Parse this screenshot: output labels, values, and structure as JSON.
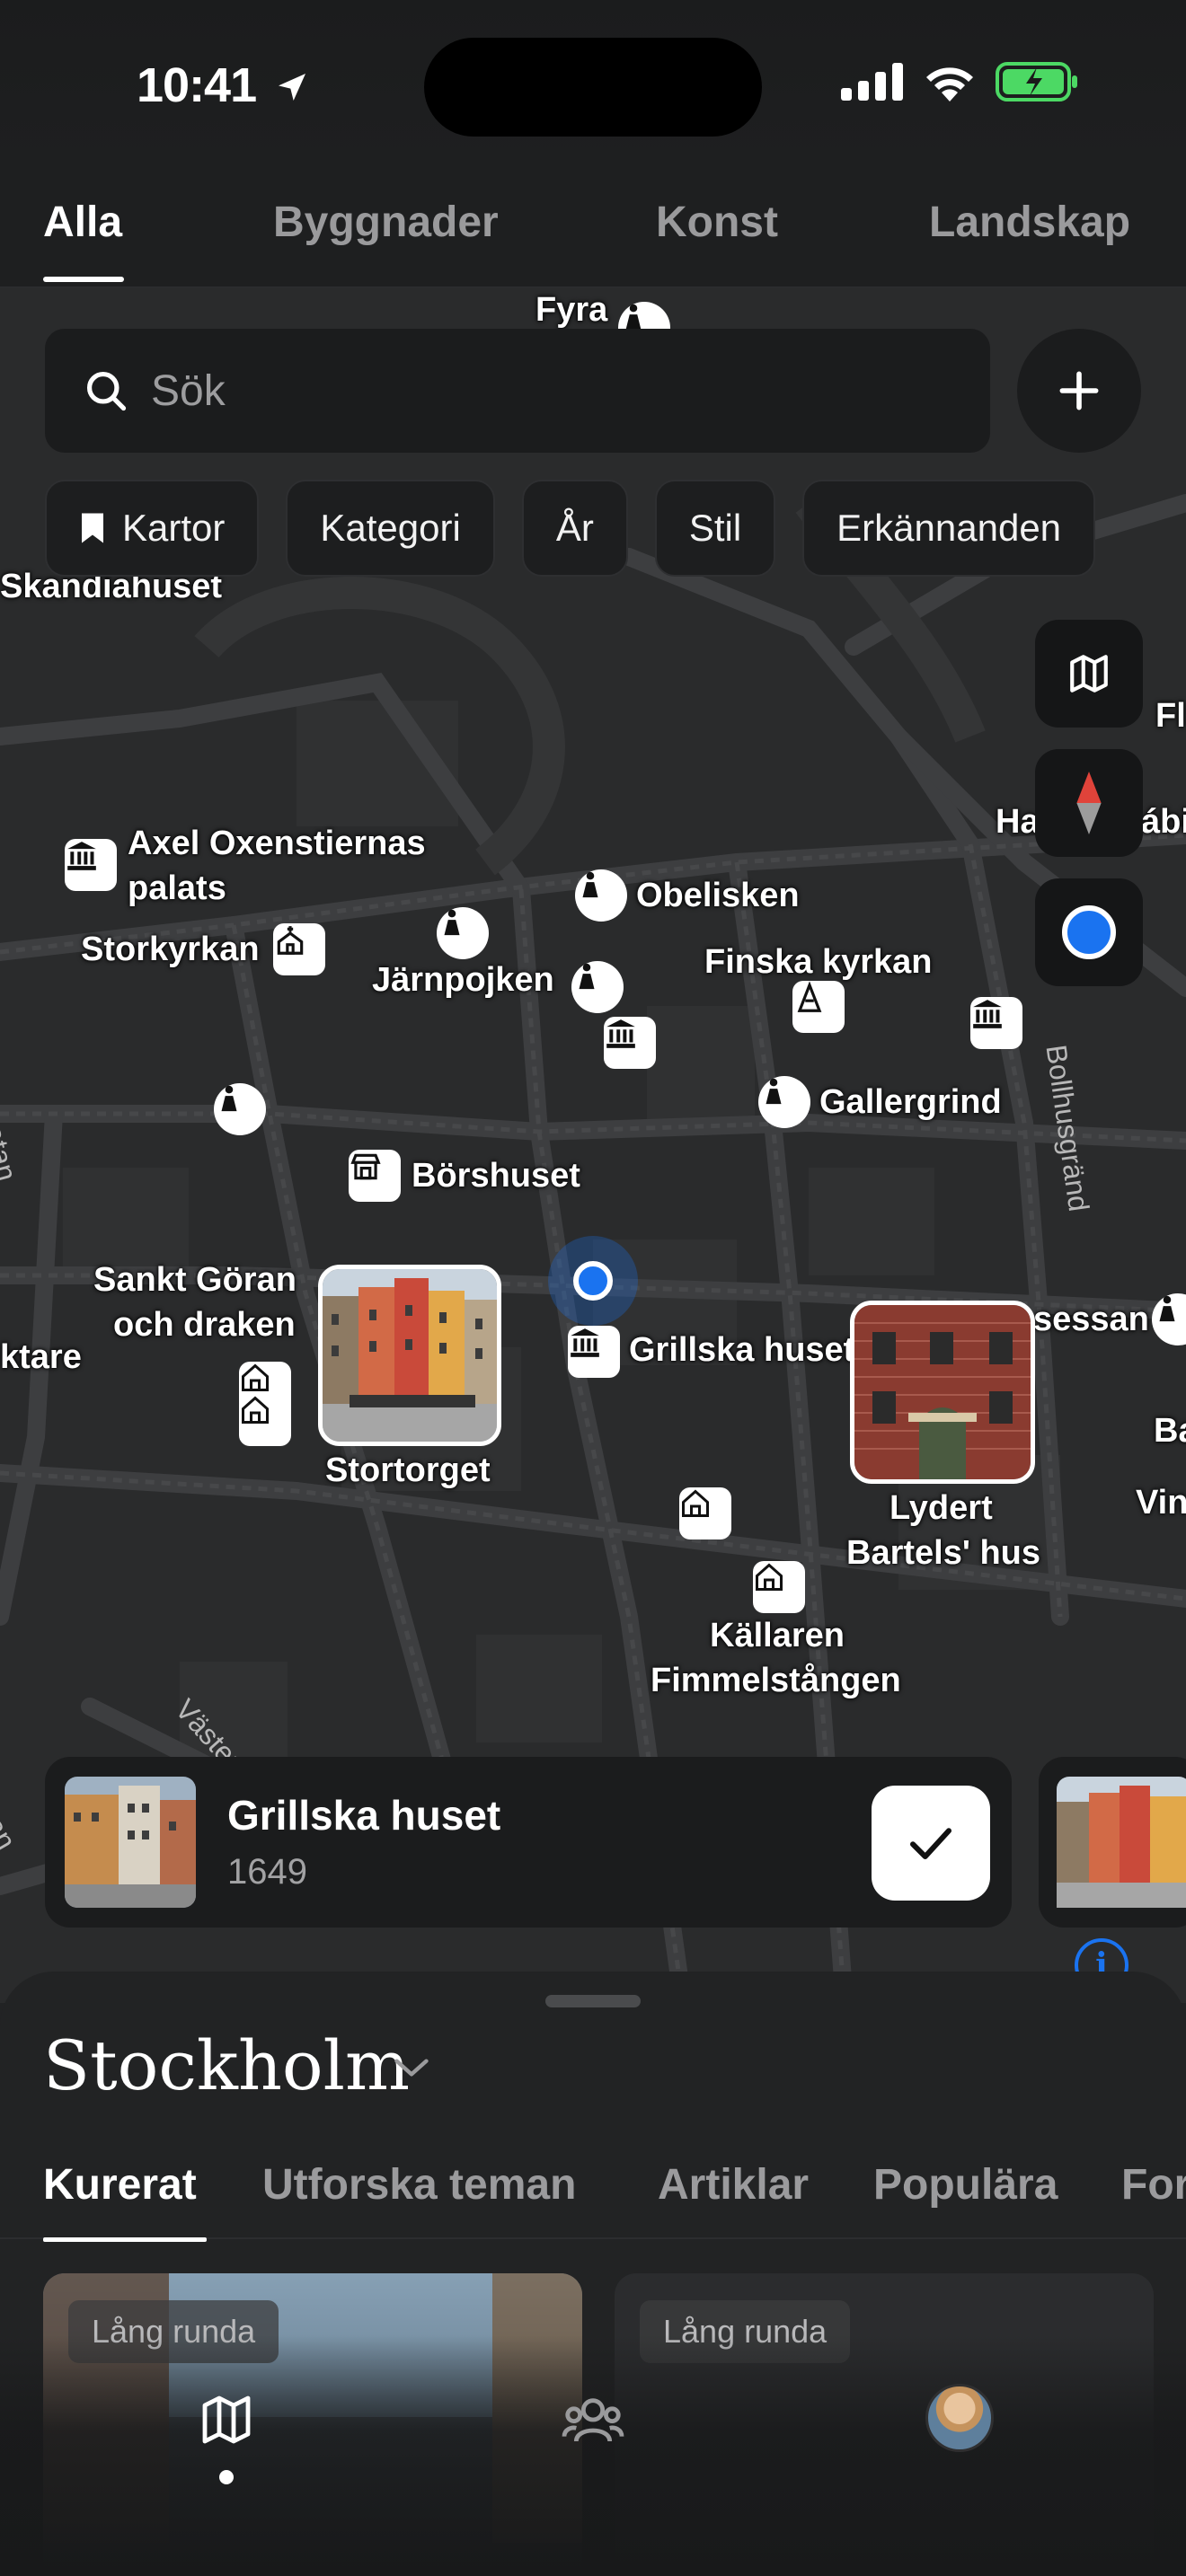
{
  "status_bar": {
    "time": "10:41"
  },
  "top_tabs": [
    "Alla",
    "Byggnader",
    "Konst",
    "Landskap"
  ],
  "search": {
    "placeholder": "Sök"
  },
  "filter_chips": [
    "Kartor",
    "Kategori",
    "År",
    "Stil",
    "Erkännanden"
  ],
  "map_labels": {
    "fyra": "Fyra",
    "skandiahuset": "Skandiahuset",
    "axel1": "Axel Oxenstiernas",
    "axel2": "palats",
    "storkyrkan": "Storkyrkan",
    "jarnpojken": "Järnpojken",
    "obelisken": "Obelisken",
    "finska": "Finska kyrkan",
    "gallergrind": "Gallergrind",
    "borshuset": "Börshuset",
    "sankt1": "Sankt Göran",
    "sankt2": "och draken",
    "ktare": "ktare",
    "grillska": "Grillska huset",
    "stortorget": "Stortorget",
    "lydert1": "Lydert",
    "lydert2": "Bartels' hus",
    "kallaren1": "Källaren",
    "kallaren2": "Fimmelstången",
    "sessan": "sessan",
    "ha": "Ha",
    "abi": "ábi",
    "fl": "Fl",
    "ba": "Ba",
    "vin": "Vin",
    "bollhusgrand": "Bollhusgränd",
    "vasterlanggatan": "Västerlå",
    "gatan_left": "gatan",
    "atan": "atan"
  },
  "selected_card": {
    "title": "Grillska huset",
    "year": "1649"
  },
  "sheet": {
    "city": "Stockholm",
    "tabs": [
      "Kurerat",
      "Utforska teman",
      "Artiklar",
      "Populära",
      "For"
    ],
    "route_badges": [
      "Lång runda",
      "Lång runda"
    ]
  },
  "icons": [
    "location-arrow-icon",
    "signal-icon",
    "wifi-icon",
    "battery-charging-icon",
    "search-icon",
    "plus-icon",
    "bookmark-icon",
    "map-icon",
    "compass-icon",
    "my-location-icon",
    "museum-icon",
    "statue-icon",
    "church-icon",
    "house-icon",
    "shop-icon",
    "check-icon",
    "chevron-down-icon",
    "map-tab-icon",
    "people-icon",
    "info-icon"
  ],
  "colors": {
    "accent_blue": "#1a73f0",
    "background": "#222324",
    "map": "#2a2b2c",
    "compass_red": "#e0433a",
    "battery_green": "#4cd964"
  }
}
